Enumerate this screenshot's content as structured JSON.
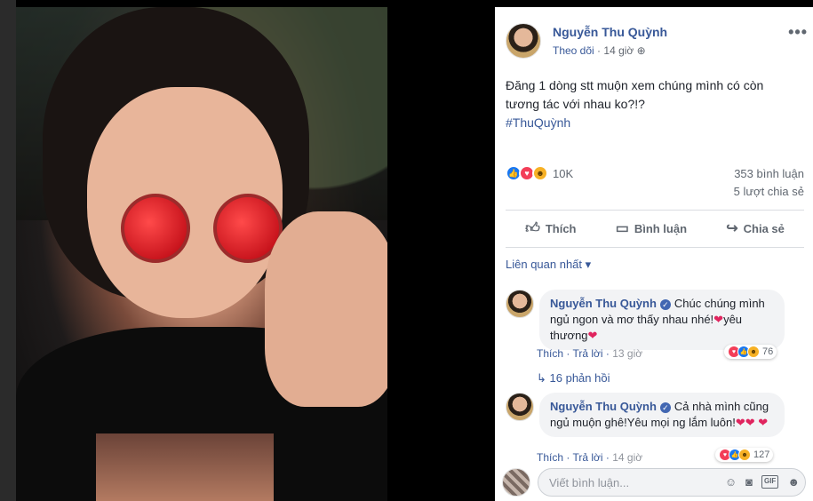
{
  "post": {
    "author": "Nguyễn Thu Quỳnh",
    "follow": "Theo dõi",
    "time": "14 giờ",
    "text": "Đăng 1 dòng stt muộn xem chúng mình có còn tương tác với nhau ko?!?",
    "hashtag": "#ThuQuỳnh",
    "reaction_count": "10K",
    "comment_count": "353 bình luận",
    "share_count": "5 lượt chia sẻ"
  },
  "actions": {
    "like": "Thích",
    "comment": "Bình luận",
    "share": "Chia sẻ"
  },
  "filter": "Liên quan nhất",
  "comments": [
    {
      "author": "Nguyễn Thu Quỳnh",
      "text_before": "Chúc chúng mình ngủ ngon và mơ thấy nhau nhé!",
      "text_after": "yêu thương",
      "reactions": "76",
      "like": "Thích",
      "reply": "Trả lời",
      "time": "13 giờ"
    },
    {
      "author": "Nguyễn Thu Quỳnh",
      "text_before": "Cả nhà mình cũng ngủ muộn ghê!Yêu mọi ng lắm luôn!",
      "text_after": "",
      "reactions": "127",
      "like": "Thích",
      "reply": "Trả lời",
      "time": "14 giờ"
    }
  ],
  "replies_link": "16 phản hồi",
  "composer": {
    "placeholder": "Viết bình luận..."
  },
  "colors": {
    "link": "#385898",
    "text": "#1d2129",
    "muted": "#606770",
    "like": "#1877f2",
    "love": "#f33e58",
    "haha": "#f7b125"
  },
  "icons": [
    "more-icon",
    "globe-icon",
    "like-icon",
    "comment-icon",
    "share-icon",
    "chevron-down-icon",
    "reply-arrow-icon",
    "emoji-icon",
    "camera-icon",
    "gif-icon",
    "sticker-icon"
  ]
}
